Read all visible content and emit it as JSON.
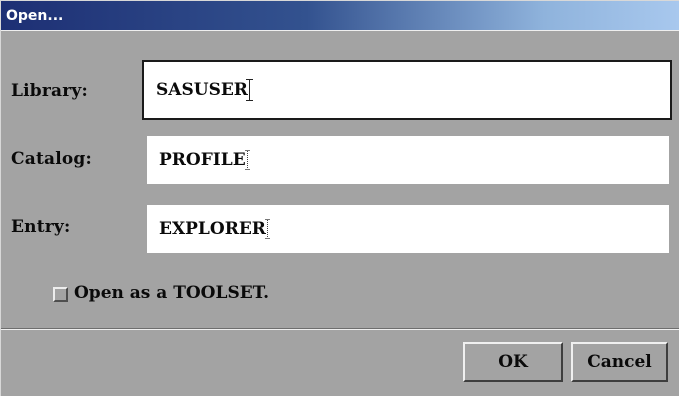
{
  "window": {
    "title": "Open..."
  },
  "fields": {
    "library": {
      "label": "Library:",
      "value": "SASUSER"
    },
    "catalog": {
      "label": "Catalog:",
      "value": "PROFILE"
    },
    "entry": {
      "label": "Entry:",
      "value": "EXPLORER"
    }
  },
  "options": {
    "open_as_toolset_label": "Open as a TOOLSET.",
    "open_as_toolset_checked": false
  },
  "buttons": {
    "ok_label": "OK",
    "cancel_label": "Cancel"
  }
}
